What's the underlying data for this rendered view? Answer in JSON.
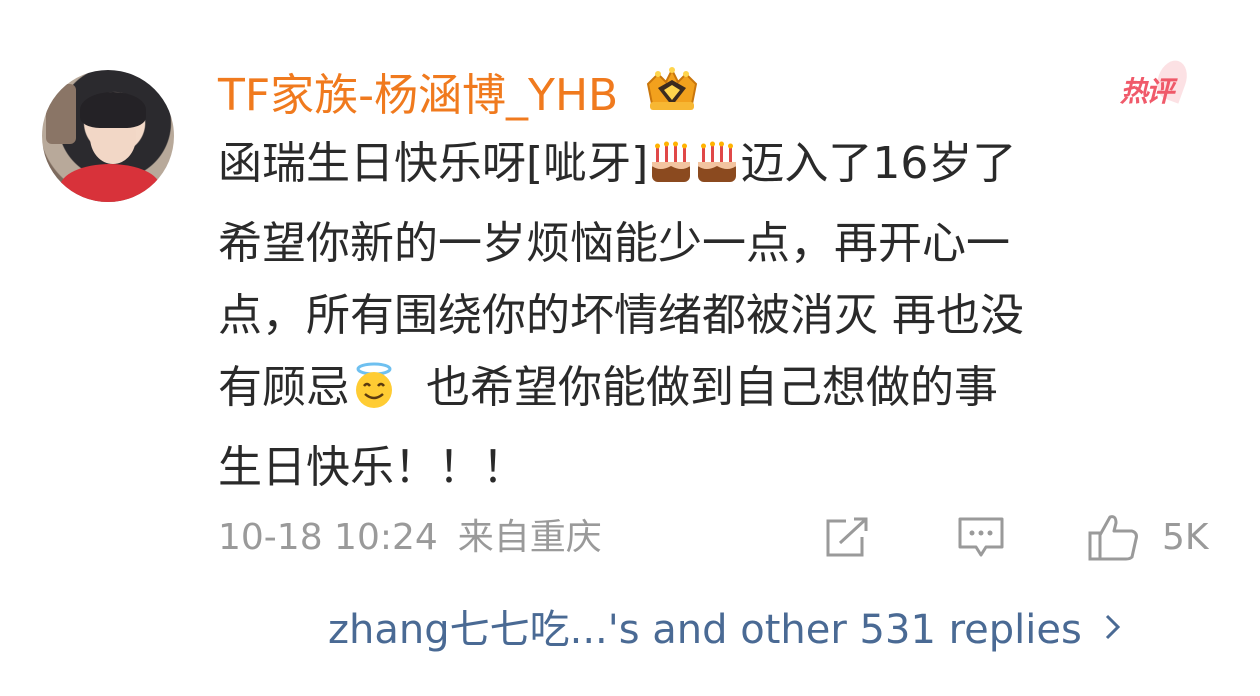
{
  "comment": {
    "username": "TF家族-杨涵博_YHB",
    "hot_badge": "热评",
    "lines": [
      "函瑞生日快乐呀[呲牙]",
      "迈入了16岁了",
      "希望你新的一岁烦恼能少一点，再开心一",
      "点，所有围绕你的坏情绪都被消灭  再也没",
      "有顾忌",
      "  也希望你能做到自己想做的事",
      "生日快乐！！！"
    ],
    "timestamp": "10-18 10:24",
    "location": "来自重庆",
    "like_count": "5K",
    "replies_text": "zhang七七吃...'s and other 531 replies"
  },
  "icons": {
    "vip": "crown-badge-icon",
    "cake": "birthday-cake-emoji",
    "halo": "halo-smile-emoji",
    "share": "share-icon",
    "comment": "comment-icon",
    "like": "thumbs-up-icon",
    "chevron": "chevron-right-icon"
  },
  "colors": {
    "username": "#f07a1e",
    "hot": "#f05a6a",
    "meta": "#9a9a9a",
    "link": "#4a6a94",
    "text": "#2a2a2a"
  }
}
